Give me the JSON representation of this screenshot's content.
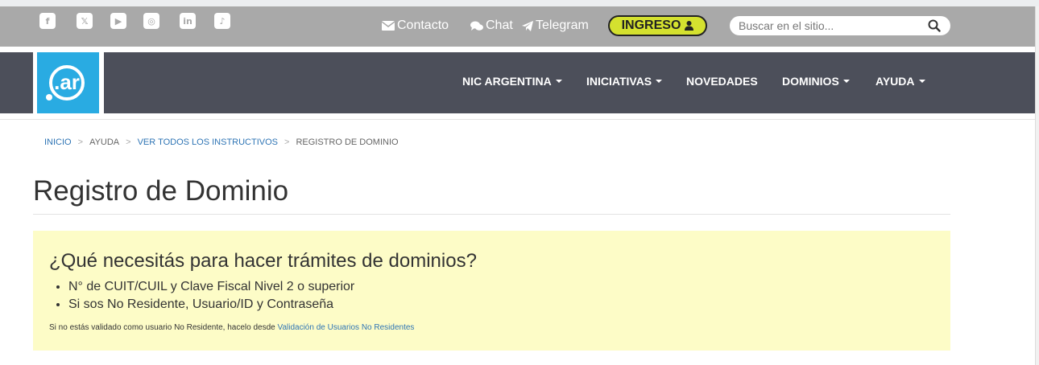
{
  "topbar": {
    "social": [
      {
        "name": "facebook-icon",
        "glyph": "f"
      },
      {
        "name": "x-twitter-icon",
        "glyph": "𝕏"
      },
      {
        "name": "youtube-icon",
        "glyph": "▶"
      },
      {
        "name": "instagram-icon",
        "glyph": "◎"
      },
      {
        "name": "linkedin-icon",
        "glyph": "in"
      },
      {
        "name": "tiktok-icon",
        "glyph": "♪"
      }
    ],
    "links": {
      "contacto": "Contacto",
      "chat": "Chat",
      "telegram": "Telegram"
    },
    "ingreso_label": "INGRESO",
    "search_placeholder": "Buscar en el sitio..."
  },
  "logo": {
    "text": ".ar"
  },
  "nav": {
    "items": [
      {
        "label": "NIC ARGENTINA",
        "dropdown": true
      },
      {
        "label": "INICIATIVAS",
        "dropdown": true
      },
      {
        "label": "NOVEDADES",
        "dropdown": false
      },
      {
        "label": "DOMINIOS",
        "dropdown": true
      },
      {
        "label": "AYUDA",
        "dropdown": true
      }
    ]
  },
  "breadcrumb": {
    "items": [
      "INICIO",
      "AYUDA",
      "VER TODOS LOS INSTRUCTIVOS",
      "REGISTRO DE DOMINIO"
    ],
    "separator": ">"
  },
  "page": {
    "title": "Registro de Dominio"
  },
  "notice": {
    "heading": "¿Qué necesitás para hacer trámites de dominios?",
    "items": [
      "N° de CUIT/CUIL y Clave Fiscal Nivel 2 o superior",
      "Si sos No Residente, Usuario/ID y Contraseña"
    ],
    "note_text": "Si no estás validado como usuario No Residente, hacelo desde",
    "note_link": "Validación de Usuarios No Residentes"
  },
  "colors": {
    "topbar": "#a9a9a9",
    "navbar": "#4c4f5a",
    "ingreso": "#d4e12f",
    "logo_blue": "#29abe2",
    "notice_bg": "#fdfcc7",
    "link": "#2f75b5"
  }
}
